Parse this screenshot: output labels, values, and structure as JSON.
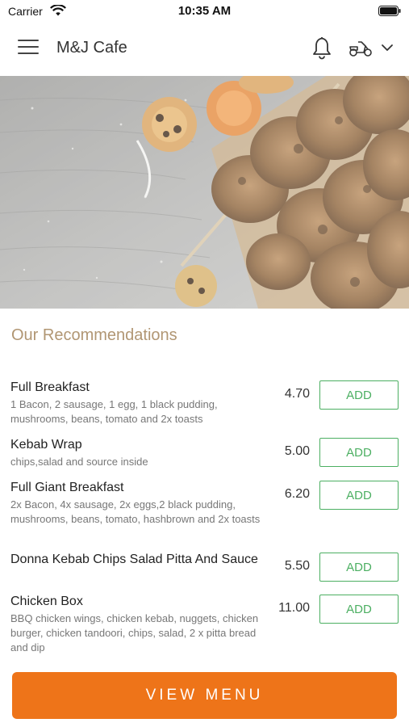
{
  "status_bar": {
    "carrier": "Carrier",
    "time": "10:35 AM"
  },
  "header": {
    "title": "M&J Cafe",
    "icons": [
      "menu-icon",
      "bell-icon",
      "delivery-scooter-icon",
      "chevron-down-icon"
    ]
  },
  "hero": {
    "image_description_icon": "food-banner-image"
  },
  "recommendations": {
    "title": "Our Recommendations",
    "add_label": "ADD",
    "items": [
      {
        "name": "Full Breakfast",
        "description": "1 Bacon, 2 sausage, 1 egg, 1 black pudding, mushrooms, beans, tomato and 2x toasts",
        "price": "4.70"
      },
      {
        "name": "Kebab Wrap",
        "description": "chips,salad and source inside",
        "price": "5.00"
      },
      {
        "name": "Full Giant Breakfast",
        "description": "2x Bacon, 4x sausage, 2x eggs,2 black pudding, mushrooms, beans, tomato, hashbrown and 2x toasts",
        "price": "6.20"
      },
      {
        "name": "Donna Kebab Chips Salad Pitta And Sauce",
        "description": "",
        "price": "5.50"
      },
      {
        "name": "Chicken Box",
        "description": "BBQ chicken wings, chicken kebab, nuggets, chicken burger, chicken tandoori, chips, salad, 2 x pitta bread and dip",
        "price": "11.00"
      }
    ]
  },
  "footer": {
    "view_menu_label": "VIEW MENU"
  },
  "colors": {
    "accent_orange": "#ee7419",
    "add_green": "#4caf62",
    "section_title": "#b19673"
  }
}
